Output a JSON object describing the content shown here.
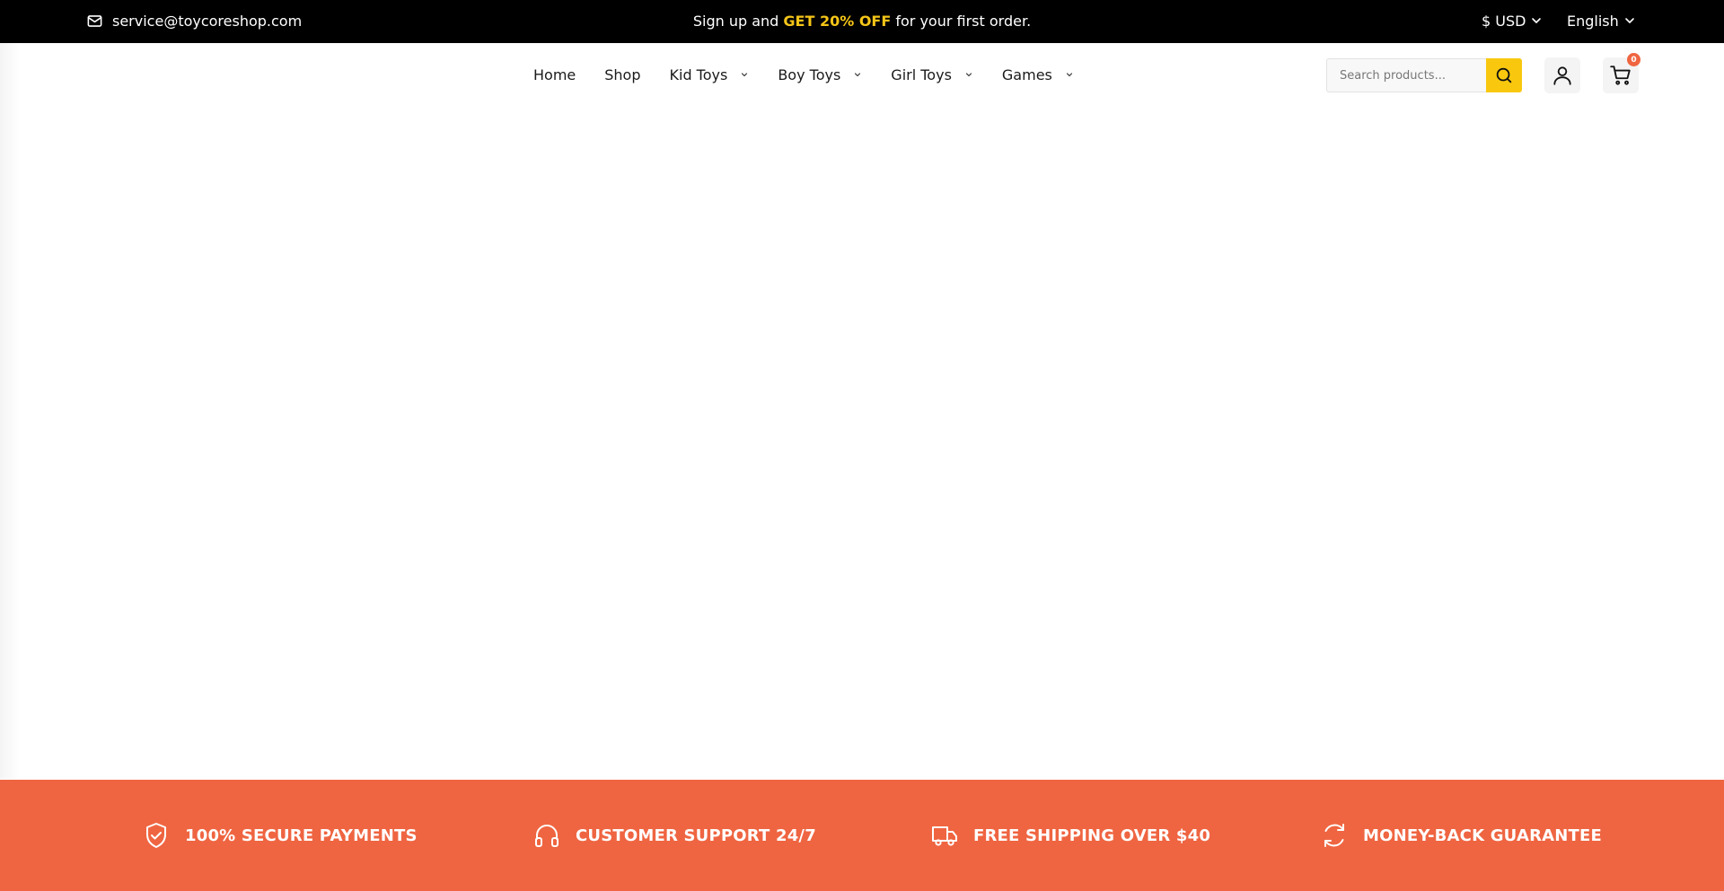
{
  "topbar": {
    "email": "service@toycoreshop.com",
    "promo": {
      "before": "Sign up and",
      "highlight": "GET 20% OFF",
      "after": "for your first order."
    },
    "currency": "$ USD",
    "language": "English",
    "highlight_color": "#f5c518"
  },
  "nav": {
    "items": [
      {
        "label": "Home",
        "has_dropdown": false
      },
      {
        "label": "Shop",
        "has_dropdown": false
      },
      {
        "label": "Kid Toys",
        "has_dropdown": true
      },
      {
        "label": "Boy Toys",
        "has_dropdown": true
      },
      {
        "label": "Girl Toys",
        "has_dropdown": true
      },
      {
        "label": "Games",
        "has_dropdown": true
      }
    ]
  },
  "search": {
    "placeholder": "Search products...",
    "button_color": "#f9c80e"
  },
  "cart": {
    "count": "0"
  },
  "features": {
    "background": "#ef6541",
    "items": [
      {
        "label": "100% SECURE PAYMENTS",
        "icon": "shield-check-icon"
      },
      {
        "label": "CUSTOMER SUPPORT 24/7",
        "icon": "headphones-icon"
      },
      {
        "label": "FREE SHIPPING OVER $40",
        "icon": "truck-icon"
      },
      {
        "label": "MONEY-BACK GUARANTEE",
        "icon": "refresh-icon"
      }
    ]
  }
}
